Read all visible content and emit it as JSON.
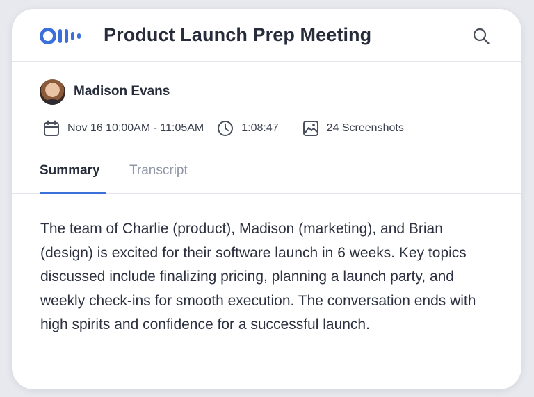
{
  "header": {
    "title": "Product Launch Prep Meeting",
    "logo_icon": "otter-logo-icon",
    "search_icon": "search-icon"
  },
  "meeting": {
    "owner_name": "Madison Evans",
    "datetime": "Nov 16 10:00AM - 11:05AM",
    "duration": "1:08:47",
    "screenshots": "24 Screenshots"
  },
  "tabs": [
    {
      "label": "Summary",
      "active": true
    },
    {
      "label": "Transcript",
      "active": false
    }
  ],
  "summary": {
    "text": "The team of Charlie (product), Madison (marketing), and Brian (design) is excited for their software launch in 6 weeks. Key topics discussed include finalizing pricing, planning a launch party, and weekly check-ins for smooth execution. The conversation ends with high spirits and confidence for a successful launch."
  },
  "colors": {
    "brand_blue": "#3b6fd9",
    "text_dark": "#272c3a",
    "text_muted": "#8f96a6"
  }
}
